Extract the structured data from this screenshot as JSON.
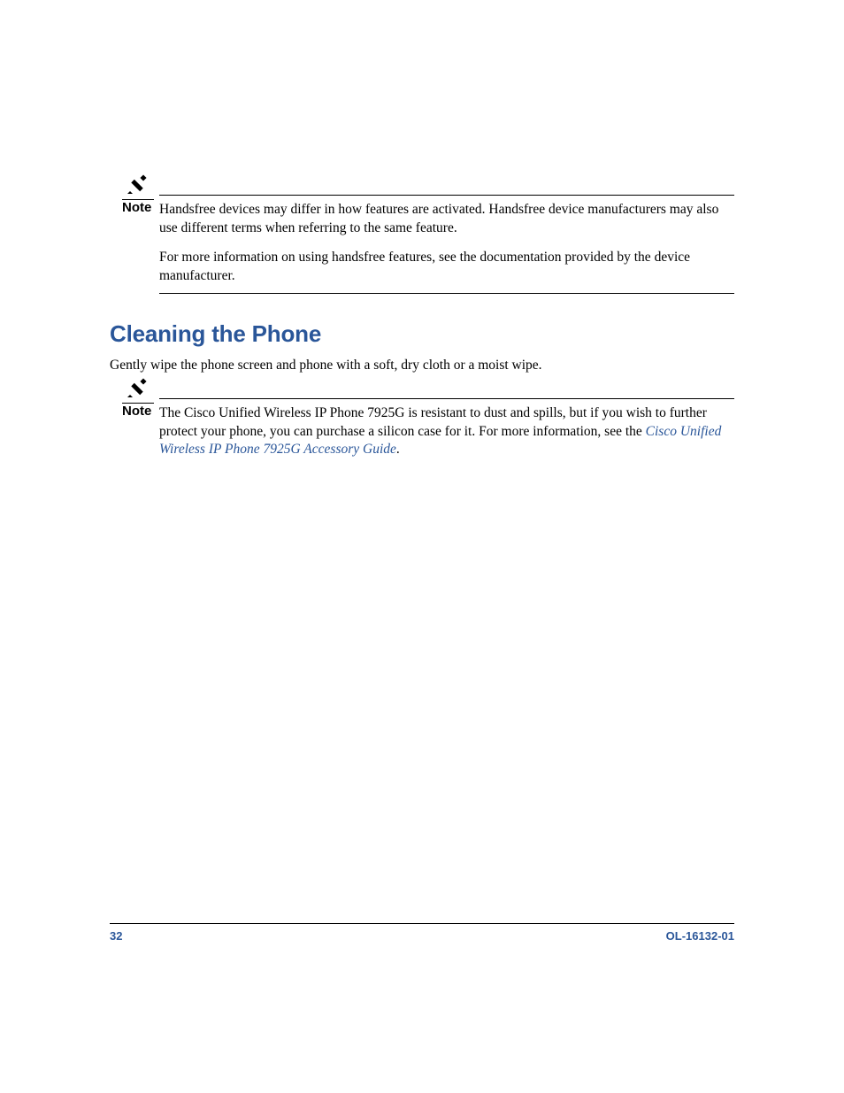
{
  "notes": [
    {
      "label": "Note",
      "paragraphs": [
        "Handsfree devices may differ in how features are activated. Handsfree device manufacturers may also use different terms when referring to the same feature.",
        "For more information on using handsfree features, see the documentation provided by the device manufacturer."
      ]
    },
    {
      "label": "Note",
      "body_before_link": "The Cisco Unified Wireless IP Phone 7925G is resistant to dust and spills, but if you wish to further protect your phone, you can purchase a silicon case for it. For more information, see the ",
      "link_text": "Cisco Unified Wireless IP Phone 7925G Accessory Guide",
      "body_after_link": "."
    }
  ],
  "heading": "Cleaning the Phone",
  "body": "Gently wipe the phone screen and phone with a soft, dry cloth or a moist wipe.",
  "footer": {
    "page_number": "32",
    "doc_id": "OL-16132-01"
  }
}
